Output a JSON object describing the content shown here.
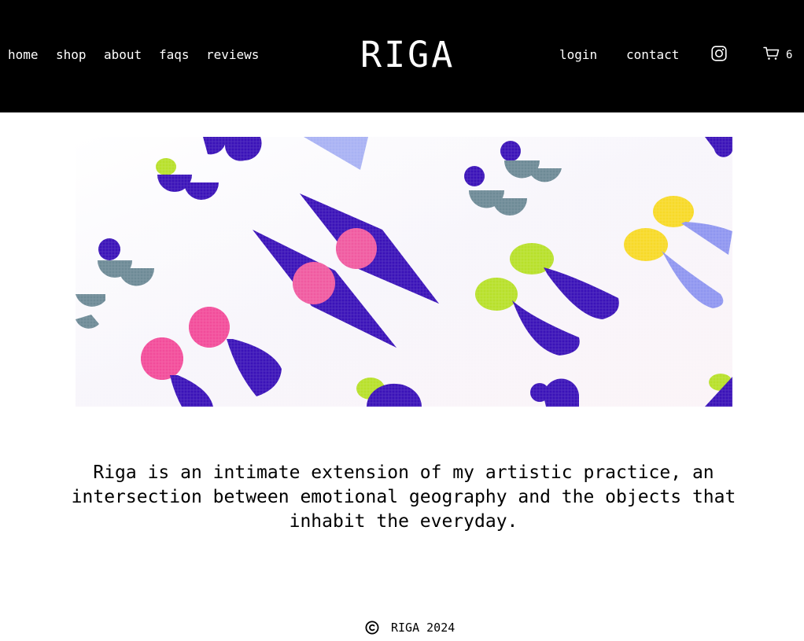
{
  "header": {
    "nav_left": [
      {
        "label": "home"
      },
      {
        "label": "shop"
      },
      {
        "label": "about"
      },
      {
        "label": "faqs"
      },
      {
        "label": "reviews"
      }
    ],
    "logo": "RIGA",
    "nav_right": [
      {
        "label": "login"
      },
      {
        "label": "contact"
      }
    ],
    "icons": {
      "social": "instagram-icon",
      "cart": "cart-icon"
    },
    "cart_count": "6"
  },
  "hero": {
    "image": "textile-earrings-photo"
  },
  "main": {
    "tagline": "Riga is an intimate extension of my artistic practice, an intersection between emotional geography and the objects that inhabit the everyday."
  },
  "footer": {
    "copyright_icon": "copyright-icon",
    "text": "RIGA 2024"
  },
  "colors": {
    "header_bg": "#000000",
    "header_text": "#ffffff",
    "page_bg": "#ffffff",
    "violet": "#3a12b8",
    "pink": "#f03f8a",
    "lime": "#b7e02a",
    "slate": "#6d8a96",
    "lavender": "#8f96f0",
    "yellow": "#f7d928"
  }
}
